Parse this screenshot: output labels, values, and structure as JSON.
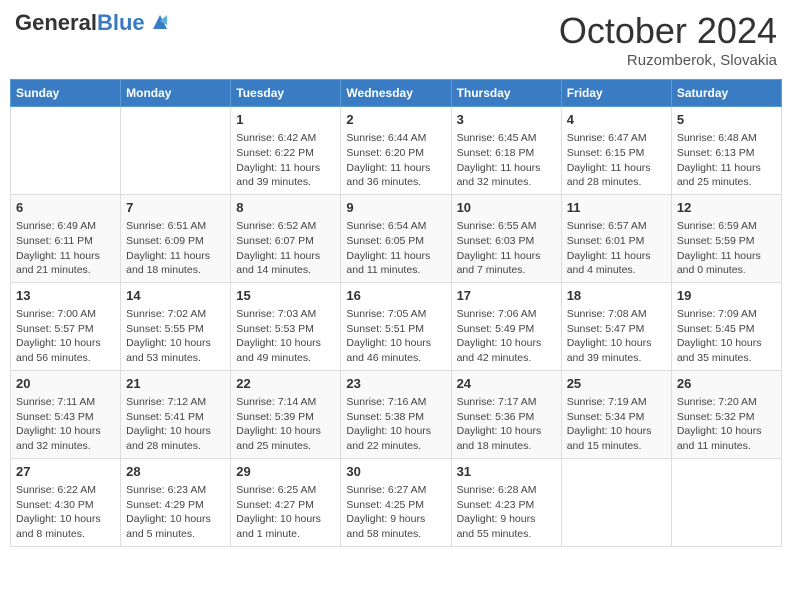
{
  "header": {
    "logo_general": "General",
    "logo_blue": "Blue",
    "month": "October 2024",
    "location": "Ruzomberok, Slovakia"
  },
  "days_of_week": [
    "Sunday",
    "Monday",
    "Tuesday",
    "Wednesday",
    "Thursday",
    "Friday",
    "Saturday"
  ],
  "weeks": [
    [
      {
        "day": "",
        "info": ""
      },
      {
        "day": "",
        "info": ""
      },
      {
        "day": "1",
        "info": "Sunrise: 6:42 AM\nSunset: 6:22 PM\nDaylight: 11 hours and 39 minutes."
      },
      {
        "day": "2",
        "info": "Sunrise: 6:44 AM\nSunset: 6:20 PM\nDaylight: 11 hours and 36 minutes."
      },
      {
        "day": "3",
        "info": "Sunrise: 6:45 AM\nSunset: 6:18 PM\nDaylight: 11 hours and 32 minutes."
      },
      {
        "day": "4",
        "info": "Sunrise: 6:47 AM\nSunset: 6:15 PM\nDaylight: 11 hours and 28 minutes."
      },
      {
        "day": "5",
        "info": "Sunrise: 6:48 AM\nSunset: 6:13 PM\nDaylight: 11 hours and 25 minutes."
      }
    ],
    [
      {
        "day": "6",
        "info": "Sunrise: 6:49 AM\nSunset: 6:11 PM\nDaylight: 11 hours and 21 minutes."
      },
      {
        "day": "7",
        "info": "Sunrise: 6:51 AM\nSunset: 6:09 PM\nDaylight: 11 hours and 18 minutes."
      },
      {
        "day": "8",
        "info": "Sunrise: 6:52 AM\nSunset: 6:07 PM\nDaylight: 11 hours and 14 minutes."
      },
      {
        "day": "9",
        "info": "Sunrise: 6:54 AM\nSunset: 6:05 PM\nDaylight: 11 hours and 11 minutes."
      },
      {
        "day": "10",
        "info": "Sunrise: 6:55 AM\nSunset: 6:03 PM\nDaylight: 11 hours and 7 minutes."
      },
      {
        "day": "11",
        "info": "Sunrise: 6:57 AM\nSunset: 6:01 PM\nDaylight: 11 hours and 4 minutes."
      },
      {
        "day": "12",
        "info": "Sunrise: 6:59 AM\nSunset: 5:59 PM\nDaylight: 11 hours and 0 minutes."
      }
    ],
    [
      {
        "day": "13",
        "info": "Sunrise: 7:00 AM\nSunset: 5:57 PM\nDaylight: 10 hours and 56 minutes."
      },
      {
        "day": "14",
        "info": "Sunrise: 7:02 AM\nSunset: 5:55 PM\nDaylight: 10 hours and 53 minutes."
      },
      {
        "day": "15",
        "info": "Sunrise: 7:03 AM\nSunset: 5:53 PM\nDaylight: 10 hours and 49 minutes."
      },
      {
        "day": "16",
        "info": "Sunrise: 7:05 AM\nSunset: 5:51 PM\nDaylight: 10 hours and 46 minutes."
      },
      {
        "day": "17",
        "info": "Sunrise: 7:06 AM\nSunset: 5:49 PM\nDaylight: 10 hours and 42 minutes."
      },
      {
        "day": "18",
        "info": "Sunrise: 7:08 AM\nSunset: 5:47 PM\nDaylight: 10 hours and 39 minutes."
      },
      {
        "day": "19",
        "info": "Sunrise: 7:09 AM\nSunset: 5:45 PM\nDaylight: 10 hours and 35 minutes."
      }
    ],
    [
      {
        "day": "20",
        "info": "Sunrise: 7:11 AM\nSunset: 5:43 PM\nDaylight: 10 hours and 32 minutes."
      },
      {
        "day": "21",
        "info": "Sunrise: 7:12 AM\nSunset: 5:41 PM\nDaylight: 10 hours and 28 minutes."
      },
      {
        "day": "22",
        "info": "Sunrise: 7:14 AM\nSunset: 5:39 PM\nDaylight: 10 hours and 25 minutes."
      },
      {
        "day": "23",
        "info": "Sunrise: 7:16 AM\nSunset: 5:38 PM\nDaylight: 10 hours and 22 minutes."
      },
      {
        "day": "24",
        "info": "Sunrise: 7:17 AM\nSunset: 5:36 PM\nDaylight: 10 hours and 18 minutes."
      },
      {
        "day": "25",
        "info": "Sunrise: 7:19 AM\nSunset: 5:34 PM\nDaylight: 10 hours and 15 minutes."
      },
      {
        "day": "26",
        "info": "Sunrise: 7:20 AM\nSunset: 5:32 PM\nDaylight: 10 hours and 11 minutes."
      }
    ],
    [
      {
        "day": "27",
        "info": "Sunrise: 6:22 AM\nSunset: 4:30 PM\nDaylight: 10 hours and 8 minutes."
      },
      {
        "day": "28",
        "info": "Sunrise: 6:23 AM\nSunset: 4:29 PM\nDaylight: 10 hours and 5 minutes."
      },
      {
        "day": "29",
        "info": "Sunrise: 6:25 AM\nSunset: 4:27 PM\nDaylight: 10 hours and 1 minute."
      },
      {
        "day": "30",
        "info": "Sunrise: 6:27 AM\nSunset: 4:25 PM\nDaylight: 9 hours and 58 minutes."
      },
      {
        "day": "31",
        "info": "Sunrise: 6:28 AM\nSunset: 4:23 PM\nDaylight: 9 hours and 55 minutes."
      },
      {
        "day": "",
        "info": ""
      },
      {
        "day": "",
        "info": ""
      }
    ]
  ]
}
